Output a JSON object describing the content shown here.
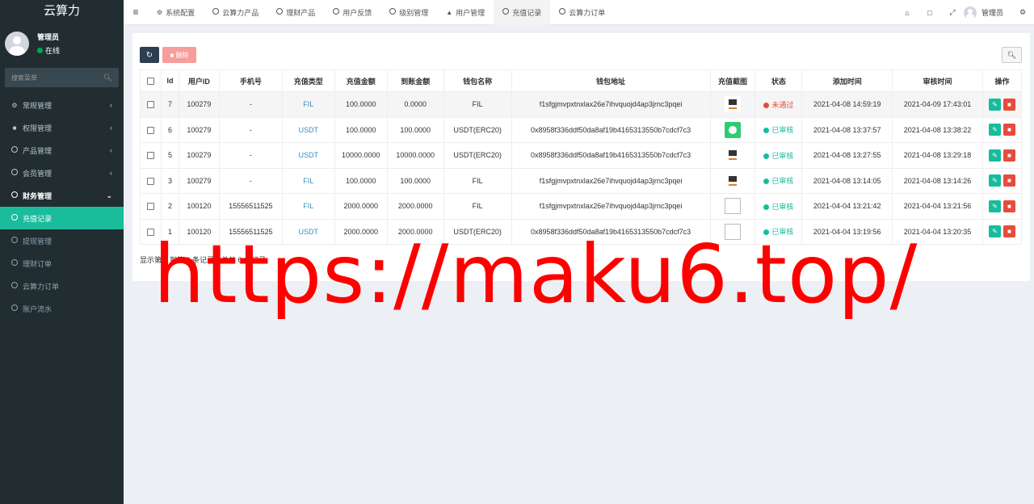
{
  "app": {
    "brand": "云算力"
  },
  "user": {
    "name": "管理员",
    "status": "在线"
  },
  "sidebar": {
    "search_placeholder": "搜索菜单",
    "items": [
      {
        "label": "常规管理",
        "icon": "cogs-icon"
      },
      {
        "label": "权限管理",
        "icon": "group-icon"
      },
      {
        "label": "产品管理",
        "icon": "circle-icon"
      },
      {
        "label": "会员管理",
        "icon": "circle-icon"
      },
      {
        "label": "财务管理",
        "icon": "circle-icon"
      },
      {
        "label": "充值记录",
        "icon": "circle-icon"
      },
      {
        "label": "提现管理",
        "icon": "circle-icon"
      },
      {
        "label": "理财订单",
        "icon": "circle-icon"
      },
      {
        "label": "云算力订单",
        "icon": "circle-icon"
      },
      {
        "label": "账户流水",
        "icon": "circle-icon"
      }
    ]
  },
  "topnav": {
    "tabs": [
      {
        "label": "系统配置",
        "icon": "gear-icon"
      },
      {
        "label": "云算力产品",
        "icon": "circle-icon"
      },
      {
        "label": "理财产品",
        "icon": "circle-icon"
      },
      {
        "label": "用户反馈",
        "icon": "circle-icon"
      },
      {
        "label": "级别管理",
        "icon": "circle-icon"
      },
      {
        "label": "用户管理",
        "icon": "user-icon"
      },
      {
        "label": "充值记录",
        "icon": "circle-icon"
      },
      {
        "label": "云算力订单",
        "icon": "circle-icon"
      }
    ],
    "admin_name": "管理员"
  },
  "toolbar": {
    "delete_label": "删除"
  },
  "table": {
    "headers": [
      "Id",
      "用户ID",
      "手机号",
      "充值类型",
      "充值金额",
      "到账金额",
      "钱包名称",
      "钱包地址",
      "充值截图",
      "状态",
      "添加时间",
      "审核时间",
      "操作"
    ],
    "rows": [
      {
        "id": "7",
        "uid": "100279",
        "phone": "-",
        "type": "FIL",
        "amount": "100.0000",
        "received": "0.0000",
        "wallet": "FIL",
        "address": "f1sfgjmvpxtnxlax26e7ihvquojd4ap3jrnc3pqei",
        "shot": "screen",
        "status": "未通过",
        "status_kind": "fail",
        "added": "2021-04-08 14:59:19",
        "reviewed": "2021-04-09 17:43:01"
      },
      {
        "id": "6",
        "uid": "100279",
        "phone": "-",
        "type": "USDT",
        "amount": "100.0000",
        "received": "100.0000",
        "wallet": "USDT(ERC20)",
        "address": "0x8958f336ddf50da8af19b4165313550b7cdcf7c3",
        "shot": "green",
        "status": "已审核",
        "status_kind": "ok",
        "added": "2021-04-08 13:37:57",
        "reviewed": "2021-04-08 13:38:22"
      },
      {
        "id": "5",
        "uid": "100279",
        "phone": "-",
        "type": "USDT",
        "amount": "10000.0000",
        "received": "10000.0000",
        "wallet": "USDT(ERC20)",
        "address": "0x8958f336ddf50da8af19b4165313550b7cdcf7c3",
        "shot": "screen",
        "status": "已审核",
        "status_kind": "ok",
        "added": "2021-04-08 13:27:55",
        "reviewed": "2021-04-08 13:29:18"
      },
      {
        "id": "3",
        "uid": "100279",
        "phone": "-",
        "type": "FIL",
        "amount": "100.0000",
        "received": "100.0000",
        "wallet": "FIL",
        "address": "f1sfgjmvpxtnxlax26e7ihvquojd4ap3jrnc3pqei",
        "shot": "screen",
        "status": "已审核",
        "status_kind": "ok",
        "added": "2021-04-08 13:14:05",
        "reviewed": "2021-04-08 13:14:26"
      },
      {
        "id": "2",
        "uid": "100120",
        "phone": "15556511525",
        "type": "FIL",
        "amount": "2000.0000",
        "received": "2000.0000",
        "wallet": "FIL",
        "address": "f1sfgjmvpxtnxlax26e7ihvquojd4ap3jrnc3pqei",
        "shot": "broken",
        "status": "已审核",
        "status_kind": "ok",
        "added": "2021-04-04 13:21:42",
        "reviewed": "2021-04-04 13:21:56"
      },
      {
        "id": "1",
        "uid": "100120",
        "phone": "15556511525",
        "type": "USDT",
        "amount": "2000.0000",
        "received": "2000.0000",
        "wallet": "USDT(ERC20)",
        "address": "0x8958f336ddf50da8af19b4165313550b7cdcf7c3",
        "shot": "broken",
        "status": "已审核",
        "status_kind": "ok",
        "added": "2021-04-04 13:19:56",
        "reviewed": "2021-04-04 13:20:35"
      }
    ]
  },
  "pager": {
    "info": "显示第 1 到第 6 条记录，总共 6 条记录"
  },
  "watermark": {
    "text": "https://maku6.top/"
  },
  "colors": {
    "sidebar_bg": "#222d32",
    "active": "#1abc9c",
    "fail": "#e74c3c",
    "ok": "#18bc9c",
    "watermark": "#ff0000"
  }
}
